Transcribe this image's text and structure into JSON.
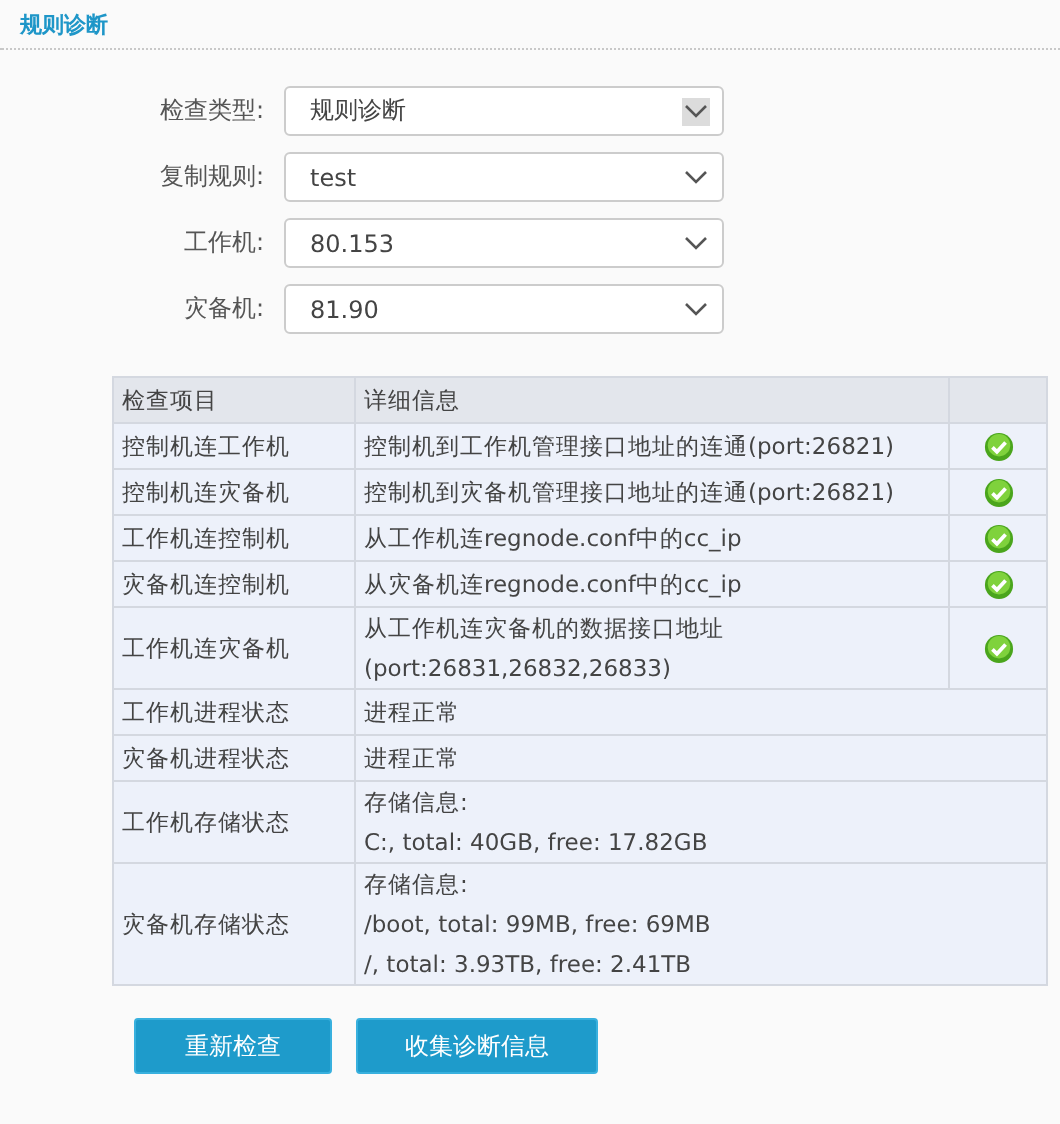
{
  "section_title": "规则诊断",
  "form": [
    {
      "label": "检查类型:",
      "value": "规则诊断",
      "caret_boxed": true
    },
    {
      "label": "复制规则:",
      "value": "test",
      "caret_boxed": false
    },
    {
      "label": "工作机:",
      "value": "80.153",
      "caret_boxed": false
    },
    {
      "label": "灾备机:",
      "value": "81.90",
      "caret_boxed": false
    }
  ],
  "table": {
    "columns": [
      "检查项目",
      "详细信息"
    ],
    "rows": [
      {
        "kind": "check",
        "item": "控制机连工作机",
        "details": [
          "控制机到工作机管理接口地址的连通(port:26821)"
        ],
        "passed": true
      },
      {
        "kind": "check",
        "item": "控制机连灾备机",
        "details": [
          "控制机到灾备机管理接口地址的连通(port:26821)"
        ],
        "passed": true
      },
      {
        "kind": "check",
        "item": "工作机连控制机",
        "details": [
          "从工作机连regnode.conf中的cc_ip"
        ],
        "passed": true
      },
      {
        "kind": "check",
        "item": "灾备机连控制机",
        "details": [
          "从灾备机连regnode.conf中的cc_ip"
        ],
        "passed": true
      },
      {
        "kind": "check",
        "item": "工作机连灾备机",
        "details": [
          "从工作机连灾备机的数据接口地址",
          "(port:26831,26832,26833)"
        ],
        "passed": true
      },
      {
        "kind": "info",
        "item": "工作机进程状态",
        "details": [
          "进程正常"
        ]
      },
      {
        "kind": "info",
        "item": "灾备机进程状态",
        "details": [
          "进程正常"
        ]
      },
      {
        "kind": "info",
        "item": "工作机存储状态",
        "details": [
          "存储信息:",
          "C:, total: 40GB, free: 17.82GB"
        ]
      },
      {
        "kind": "info",
        "item": "灾备机存储状态",
        "details": [
          "存储信息:",
          "/boot, total: 99MB, free: 69MB",
          "/, total: 3.93TB, free: 2.41TB"
        ]
      }
    ]
  },
  "buttons": [
    "重新检查",
    "收集诊断信息"
  ]
}
